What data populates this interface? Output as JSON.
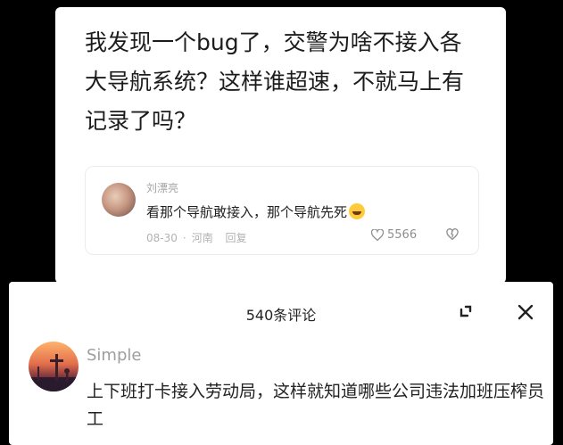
{
  "post": {
    "text": "我发现一个bug了，交警为啥不接入各大导航系统？这样谁超速，不就马上有记录了吗？"
  },
  "reply": {
    "username": "刘漂亮",
    "text": "看那个导航敢接入，那个导航先死",
    "emoji_icon": "rofl-emoji-icon",
    "date": "08-30",
    "separator": "·",
    "location": "河南",
    "reply_label": "回复",
    "likes": "5566"
  },
  "sheet": {
    "title": "540条评论",
    "comment": {
      "username": "Simple",
      "text": "上下班打卡接入劳动局，这样就知道哪些公司违法加班压榨员工"
    }
  }
}
